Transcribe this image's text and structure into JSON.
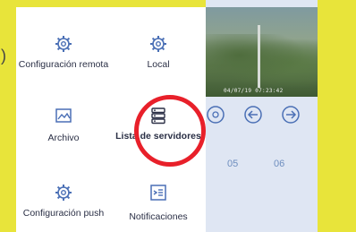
{
  "page": {
    "left_fragment": ")"
  },
  "menu": {
    "items": [
      {
        "label": "Configuración remota",
        "icon": "gear-icon"
      },
      {
        "label": "Local",
        "icon": "gear-icon"
      },
      {
        "label": "Archivo",
        "icon": "image-icon"
      },
      {
        "label": "Lista de servidores",
        "icon": "server-list-icon"
      },
      {
        "label": "Configuración push",
        "icon": "gear-icon"
      },
      {
        "label": "Notificaciones",
        "icon": "notification-icon"
      }
    ],
    "highlighted_item": "Lista de servidores"
  },
  "camera": {
    "timestamp": "04/07/19 07:23:42"
  },
  "controls": {
    "icons": [
      "settings-circle-icon",
      "arrow-left-circle-icon",
      "arrow-right-circle-icon"
    ]
  },
  "timeline": {
    "labels": [
      "05",
      "06"
    ]
  },
  "colors": {
    "background": "#e8e43a",
    "menu_text": "#2a2f45",
    "highlight": "#e8202a",
    "accent_blue": "#4a6fb5",
    "panel_bg": "#dfe6f3"
  }
}
